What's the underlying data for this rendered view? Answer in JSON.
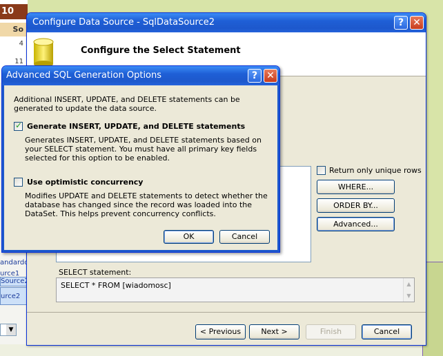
{
  "background": {
    "calendar_head": "10",
    "calendar_dow": "So",
    "calendar_days": [
      "4",
      "11"
    ],
    "fragments": [
      "andardov",
      "urce1",
      "Source2",
      "urce2"
    ]
  },
  "wizard": {
    "title": "Configure Data Source - SqlDataSource2",
    "heading": "Configure the Select Statement",
    "unique_rows_label": "Return only unique rows",
    "where_label": "WHERE...",
    "order_by_label": "ORDER BY...",
    "advanced_label": "Advanced...",
    "select_statement_label": "SELECT statement:",
    "select_statement": "SELECT * FROM [wiadomosc]",
    "previous_label": "< Previous",
    "next_label": "Next >",
    "finish_label": "Finish",
    "cancel_label": "Cancel"
  },
  "dialog": {
    "title": "Advanced SQL Generation Options",
    "intro": "Additional INSERT, UPDATE, and DELETE statements can be generated to update the data source.",
    "opt1_label": "Generate INSERT, UPDATE, and DELETE statements",
    "opt1_checked": true,
    "opt1_desc": "Generates INSERT, UPDATE, and DELETE statements based on your SELECT statement. You must have all primary key fields selected for this option to be enabled.",
    "opt2_label": "Use optimistic concurrency",
    "opt2_checked": false,
    "opt2_desc": "Modifies UPDATE and DELETE statements to detect whether the database has changed since the record was loaded into the DataSet. This helps prevent concurrency conflicts.",
    "ok_label": "OK",
    "cancel_label": "Cancel"
  },
  "icons": {
    "help": "?",
    "close": "✕",
    "scroll_up": "▲",
    "scroll_down": "▼",
    "dropdown": "▼"
  },
  "colors": {
    "titlebar": "#1d58cc",
    "dialog_bg": "#ece9d8",
    "check": "#21a121"
  }
}
